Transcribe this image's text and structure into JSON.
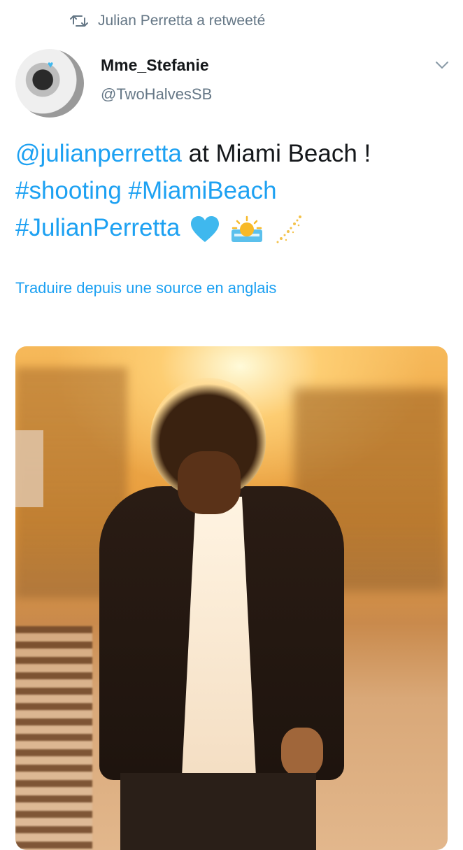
{
  "retweet": {
    "icon": "retweet-icon",
    "text": "Julian Perretta a retweeté"
  },
  "author": {
    "name": "Mme_Stefanie",
    "handle": "@TwoHalvesSB",
    "avatar_heart": "♥"
  },
  "tweet": {
    "mention": "@julianperretta",
    "text_1": " at Miami Beach !",
    "hashtag_1": "#shooting",
    "hashtag_2": "#MiamiBeach",
    "hashtag_3": "#JulianPerretta",
    "emojis": [
      "blue-heart-icon",
      "sunrise-icon",
      "sparkles-icon"
    ]
  },
  "translate_label": "Traduire depuis une source en anglais",
  "colors": {
    "link": "#1da1f2",
    "muted": "#657786",
    "text": "#14171a",
    "heart": "#3fb8ee"
  }
}
